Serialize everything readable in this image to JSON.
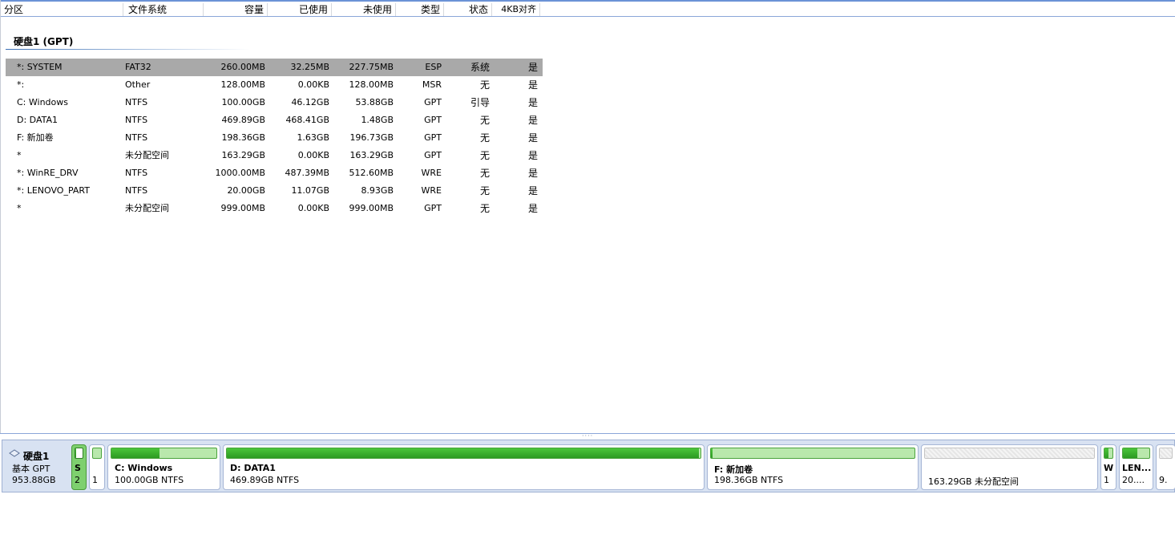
{
  "columns": {
    "partition": "分区",
    "filesystem": "文件系统",
    "capacity": "容量",
    "used": "已使用",
    "unused": "未使用",
    "type": "类型",
    "status": "状态",
    "align4k": "4KB对齐"
  },
  "disk_group": {
    "title": "硬盘1 (GPT)"
  },
  "rows": [
    {
      "name": "*: SYSTEM",
      "fs": "FAT32",
      "cap": "260.00MB",
      "used": "32.25MB",
      "free": "227.75MB",
      "type": "ESP",
      "status": "系统",
      "align": "是"
    },
    {
      "name": "*:",
      "fs": "Other",
      "cap": "128.00MB",
      "used": "0.00KB",
      "free": "128.00MB",
      "type": "MSR",
      "status": "无",
      "align": "是"
    },
    {
      "name": "C: Windows",
      "fs": "NTFS",
      "cap": "100.00GB",
      "used": "46.12GB",
      "free": "53.88GB",
      "type": "GPT",
      "status": "引导",
      "align": "是"
    },
    {
      "name": "D: DATA1",
      "fs": "NTFS",
      "cap": "469.89GB",
      "used": "468.41GB",
      "free": "1.48GB",
      "type": "GPT",
      "status": "无",
      "align": "是"
    },
    {
      "name": "F: 新加卷",
      "fs": "NTFS",
      "cap": "198.36GB",
      "used": "1.63GB",
      "free": "196.73GB",
      "type": "GPT",
      "status": "无",
      "align": "是"
    },
    {
      "name": "*",
      "fs": "未分配空间",
      "cap": "163.29GB",
      "used": "0.00KB",
      "free": "163.29GB",
      "type": "GPT",
      "status": "无",
      "align": "是"
    },
    {
      "name": "*: WinRE_DRV",
      "fs": "NTFS",
      "cap": "1000.00MB",
      "used": "487.39MB",
      "free": "512.60MB",
      "type": "WRE",
      "status": "无",
      "align": "是"
    },
    {
      "name": "*: LENOVO_PART",
      "fs": "NTFS",
      "cap": "20.00GB",
      "used": "11.07GB",
      "free": "8.93GB",
      "type": "WRE",
      "status": "无",
      "align": "是"
    },
    {
      "name": "*",
      "fs": "未分配空间",
      "cap": "999.00MB",
      "used": "0.00KB",
      "free": "999.00MB",
      "type": "GPT",
      "status": "无",
      "align": "是"
    }
  ],
  "disk_map": {
    "disk_name": "硬盘1",
    "disk_type": "基本 GPT",
    "disk_size": "953.88GB",
    "partitions": [
      {
        "label": "S",
        "info": "2",
        "used_fraction": 0.12
      },
      {
        "label": "",
        "info": "1",
        "used_fraction": 0
      },
      {
        "label": "C: Windows",
        "info": "100.00GB NTFS",
        "used_fraction": 0.46
      },
      {
        "label": "D: DATA1",
        "info": "469.89GB NTFS",
        "used_fraction": 0.997
      },
      {
        "label": "F: 新加卷",
        "info": "198.36GB NTFS",
        "used_fraction": 0.008
      },
      {
        "label": "",
        "info": "163.29GB 未分配空间",
        "used_fraction": 0
      },
      {
        "label": "W",
        "info": "1",
        "used_fraction": 0.49
      },
      {
        "label": "LEN...",
        "info": "20....",
        "used_fraction": 0.55
      },
      {
        "label": "",
        "info": "9.",
        "used_fraction": 0
      }
    ]
  },
  "colors": {
    "used": "#2c9a22",
    "free": "#b9e8ac",
    "selected_row": "#a9a9a9",
    "map_bg": "#d8e2f2"
  }
}
